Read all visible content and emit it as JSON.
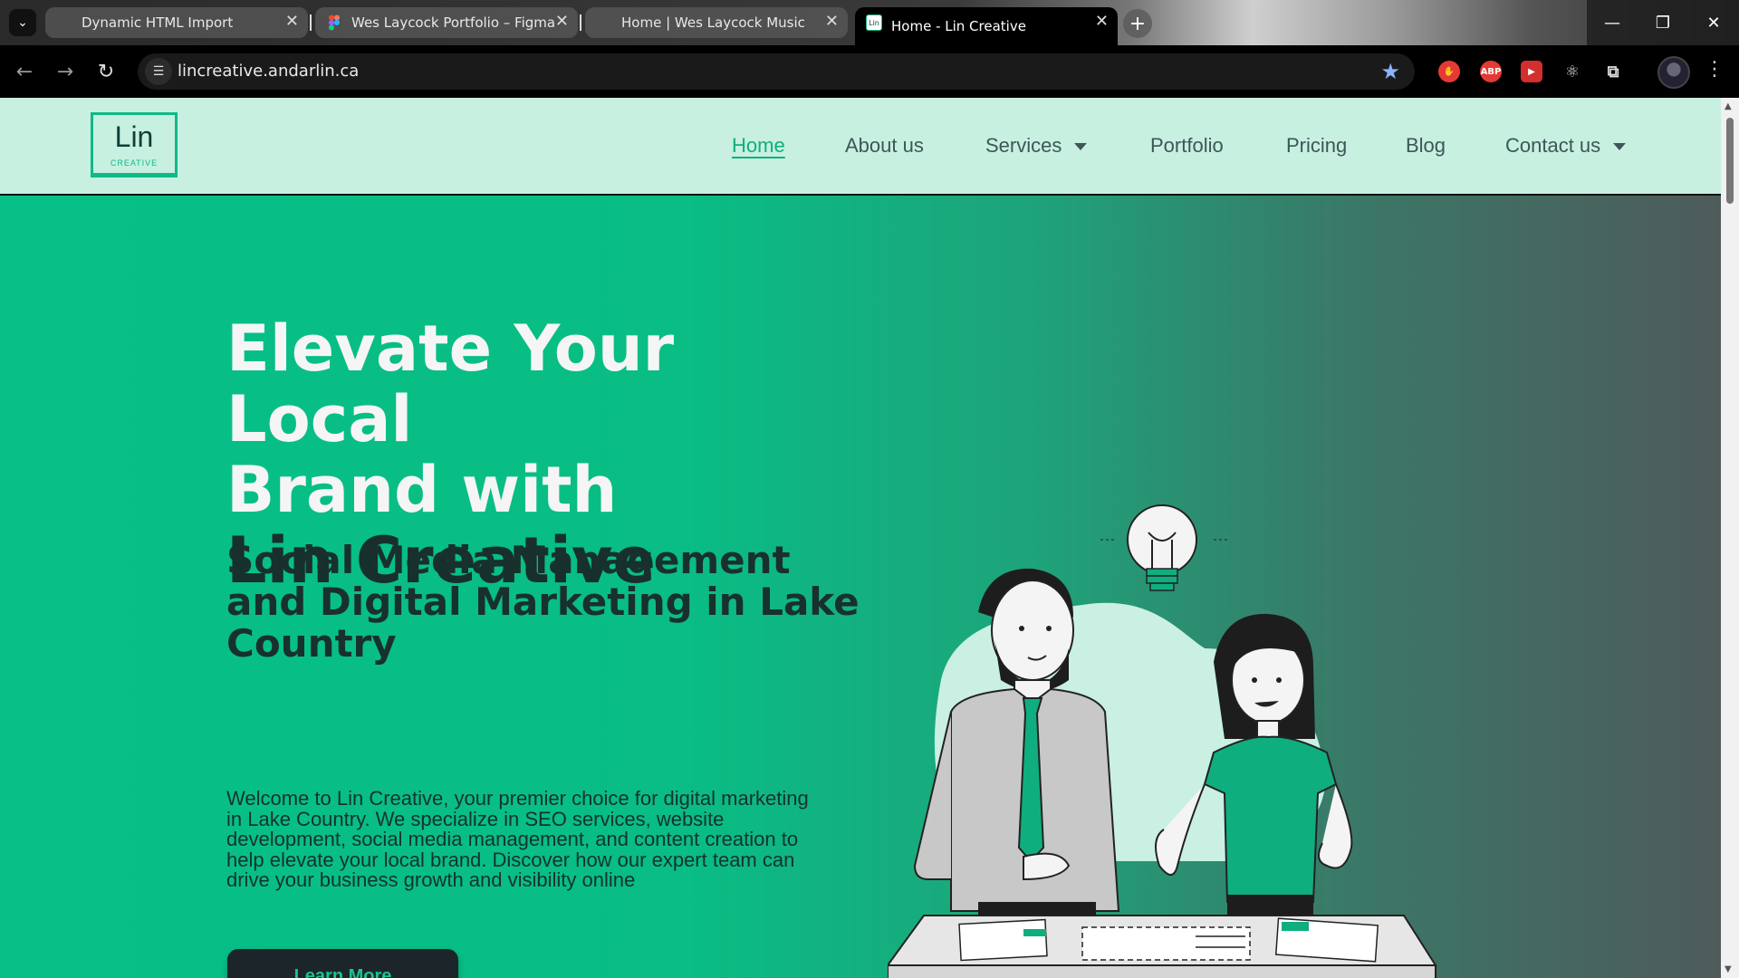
{
  "browser": {
    "tabs": [
      {
        "title": "Dynamic HTML Import",
        "active": false
      },
      {
        "title": "Wes Laycock Portfolio – Figma",
        "active": false
      },
      {
        "title": "Home | Wes Laycock Music",
        "active": false
      },
      {
        "title": "Home - Lin Creative",
        "active": true
      }
    ],
    "url": "lincreative.andarlin.ca",
    "new_tab_glyph": "+",
    "close_glyph": "✕",
    "extensions": [
      "ABP"
    ],
    "favicon_label": "Lin"
  },
  "site": {
    "logo": {
      "main": "Lin",
      "sub": "CREATIVE"
    },
    "nav": [
      {
        "label": "Home"
      },
      {
        "label": "About us"
      },
      {
        "label": "Services"
      },
      {
        "label": "Portfolio"
      },
      {
        "label": "Pricing"
      },
      {
        "label": "Blog"
      },
      {
        "label": "Contact us"
      }
    ],
    "hero": {
      "title_line1": "Elevate Your Local",
      "title_line2": "Brand with",
      "title_line3": "Lin Creative",
      "subtitle": "Social Media Management and Digital Marketing in Lake Country",
      "lead": "Welcome to Lin Creative, your premier choice for digital marketing in Lake Country. We specialize in SEO services, website development, social media management, and content creation to help elevate your local brand. Discover how our expert team can drive your business growth and visibility online",
      "cta_label": "Learn More"
    }
  },
  "colors": {
    "accent": "#10b985",
    "header_bg": "#c7f0e1",
    "hero_start": "#06c087",
    "hero_end": "#4e5b5a",
    "dark_text": "#17302b",
    "button_bg": "#1b252a"
  }
}
